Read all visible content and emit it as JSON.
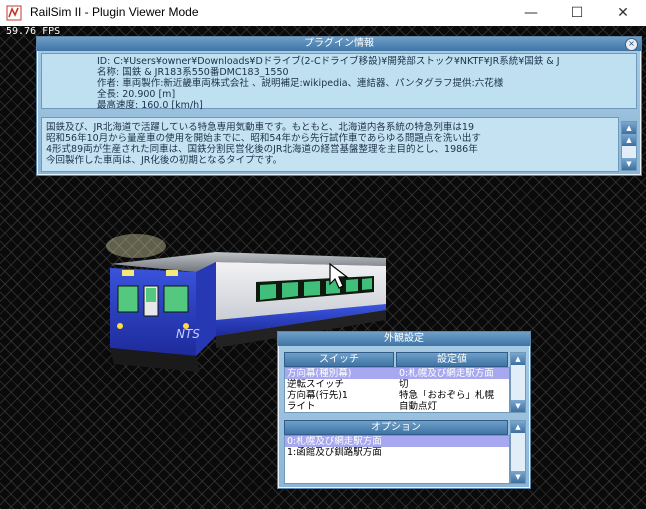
{
  "window": {
    "title": "RailSim II - Plugin Viewer Mode",
    "minimize": "—",
    "maximize": "☐",
    "close": "✕"
  },
  "viewport": {
    "fps": "59.76 FPS"
  },
  "plugin_info": {
    "title": "プラグイン情報",
    "close_symbol": "×",
    "lines": [
      "ID: C:¥Users¥owner¥Downloads¥Dドライブ(2-Cドライブ移設)¥開発部ストック¥NKTF¥JR系統¥国鉄 & J",
      "名称: 国鉄 & JR183系550番DMC183_1550",
      "作者: 車両製作:新近畿車両株式会社 、説明補足:wikipedia、連結器、パンタグラフ提供:六花様",
      "全長: 20.900 [m]",
      "最高速度: 160.0 [km/h]"
    ],
    "description": [
      "国鉄及び、JR北海道で活躍している特急専用気動車です。もともと、北海道内各系統の特急列車は19",
      "昭和56年10月から量産車の使用を開始までに、昭和54年から先行試作車であらゆる問題点を洗い出す",
      "4形式89両が生産された同車は、国鉄分割民営化後のJR北海道の経営基盤整理を主目的とし、1986年",
      "今回製作した車両は、JR化後の初期となるタイプです。"
    ]
  },
  "appearance": {
    "title": "外観設定",
    "col_switch": "スイッチ",
    "col_value": "設定値",
    "switches": [
      {
        "name": "方向幕(種別幕)",
        "value": "0:札幌及び網走駅方面",
        "selected": true
      },
      {
        "name": "逆転スイッチ",
        "value": "切",
        "selected": false
      },
      {
        "name": "方向幕(行先)1",
        "value": "特急「おおぞら」札幌",
        "selected": false
      },
      {
        "name": "ライト",
        "value": "自動点灯",
        "selected": false
      }
    ],
    "options_title": "オプション",
    "options": [
      {
        "label": "0:札幌及び網走駅方面",
        "selected": true
      },
      {
        "label": "1:函館及び釧路駅方面",
        "selected": false
      }
    ]
  },
  "colors": {
    "panel": "#8db6d6",
    "panel_header": "#3f74a6",
    "selection": "#a8a8f0",
    "train_blue": "#2e43c8"
  }
}
